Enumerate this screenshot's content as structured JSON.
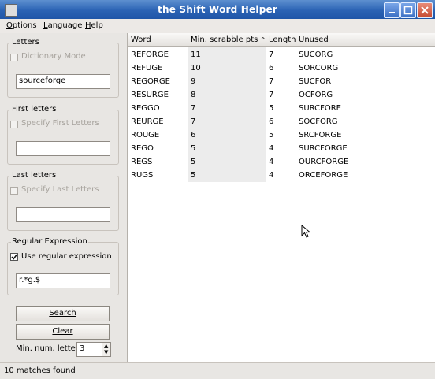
{
  "window": {
    "title": "the Shift Word Helper"
  },
  "menu": [
    {
      "label": "Options",
      "mnemonic": "O",
      "rest": "ptions"
    },
    {
      "label": "Language",
      "mnemonic": "L",
      "rest": "anguage"
    },
    {
      "label": "Help",
      "mnemonic": "H",
      "rest": "elp"
    }
  ],
  "letters": {
    "title": "Letters",
    "dictionary_mode": {
      "label": "Dictionary Mode",
      "checked": false
    },
    "value": "sourceforge"
  },
  "first_letters": {
    "title": "First letters",
    "checkbox": {
      "label": "Specify First Letters",
      "checked": false
    },
    "value": ""
  },
  "last_letters": {
    "title": "Last letters",
    "checkbox": {
      "label": "Specify Last Letters",
      "checked": false
    },
    "value": ""
  },
  "regex": {
    "title": "Regular Expression",
    "checkbox": {
      "label": "Use regular expression",
      "checked": true
    },
    "value": "r.*g.$"
  },
  "buttons": {
    "search": "Search",
    "clear": "Clear"
  },
  "min_letters": {
    "label": "Min. num. letters",
    "value": "3"
  },
  "table": {
    "columns": [
      "Word",
      "Min. scrabble pts",
      "Length",
      "Unused"
    ],
    "sort_indicator": "^",
    "rows": [
      [
        "REFORGE",
        "11",
        "7",
        "SUCORG"
      ],
      [
        "REFUGE",
        "10",
        "6",
        "SORCORG"
      ],
      [
        "REGORGE",
        "9",
        "7",
        "SUCFOR"
      ],
      [
        "RESURGE",
        "8",
        "7",
        "OCFORG"
      ],
      [
        "REGGO",
        "7",
        "5",
        "SURCFORE"
      ],
      [
        "REURGE",
        "7",
        "6",
        "SOCFORG"
      ],
      [
        "ROUGE",
        "6",
        "5",
        "SRCFORGE"
      ],
      [
        "REGO",
        "5",
        "4",
        "SURCFORGE"
      ],
      [
        "REGS",
        "5",
        "4",
        "OURCFORGE"
      ],
      [
        "RUGS",
        "5",
        "4",
        "ORCEFORGE"
      ]
    ]
  },
  "status": "10 matches found"
}
